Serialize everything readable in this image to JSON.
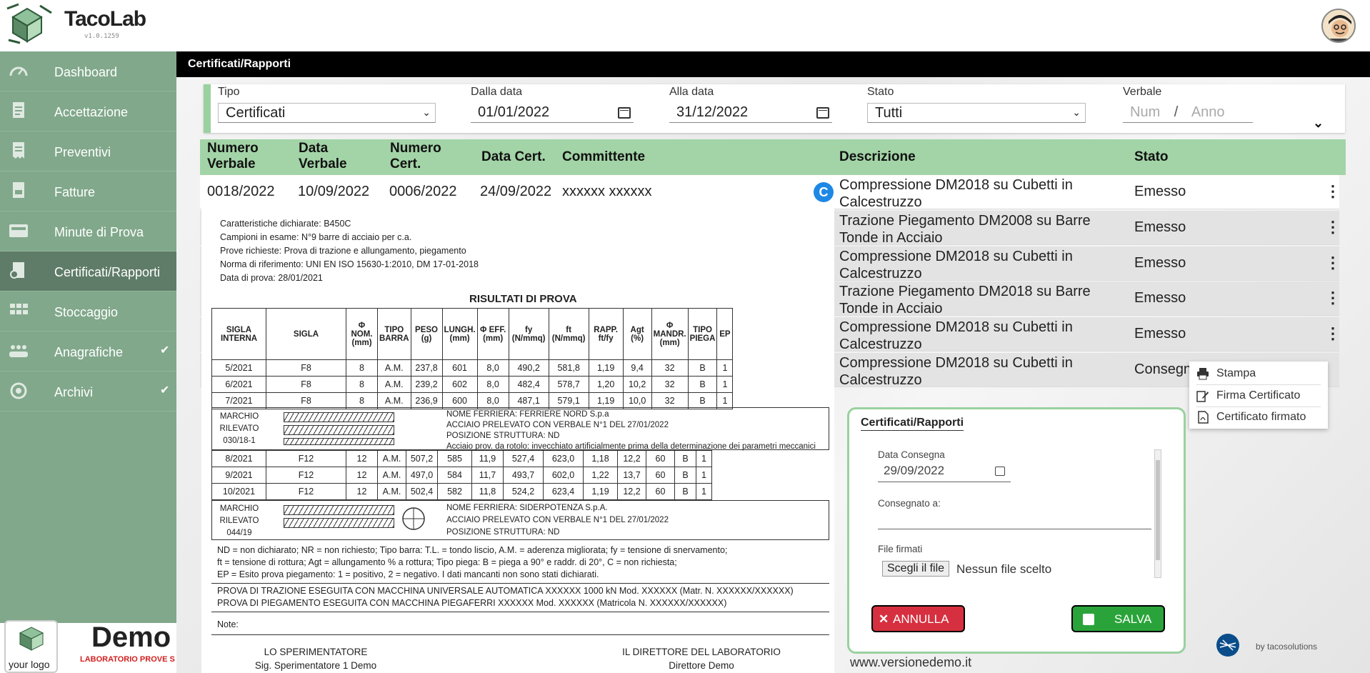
{
  "app": {
    "brand": "TacoLab",
    "version": "v1.0.1259"
  },
  "sidebar": {
    "items": [
      {
        "label": "Dashboard",
        "icon": "gauge-icon"
      },
      {
        "label": "Accettazione",
        "icon": "document-icon"
      },
      {
        "label": "Preventivi",
        "icon": "receipt-icon"
      },
      {
        "label": "Fatture",
        "icon": "invoice-icon"
      },
      {
        "label": "Minute di Prova",
        "icon": "inbox-icon"
      },
      {
        "label": "Certificati/Rapporti",
        "icon": "certificate-icon",
        "active": true
      },
      {
        "label": "Stoccaggio",
        "icon": "grid-icon"
      },
      {
        "label": "Anagrafiche",
        "icon": "people-icon",
        "expand": "✔"
      },
      {
        "label": "Archivi",
        "icon": "archive-icon",
        "expand": "✔"
      }
    ]
  },
  "page": {
    "title": "Certificati/Rapporti"
  },
  "filters": {
    "tipo": {
      "label": "Tipo",
      "value": "Certificati"
    },
    "dalla_data": {
      "label": "Dalla data",
      "value": "01/01/2022"
    },
    "alla_data": {
      "label": "Alla data",
      "value": "31/12/2022"
    },
    "stato": {
      "label": "Stato",
      "value": "Tutti"
    },
    "verbale": {
      "label": "Verbale",
      "num_placeholder": "Num",
      "sep": "/",
      "anno_placeholder": "Anno"
    }
  },
  "table": {
    "headers": {
      "numero_verbale": "Numero Verbale",
      "data_verbale": "Data Verbale",
      "numero_cert": "Numero Cert.",
      "data_cert": "Data Cert.",
      "committente": "Committente",
      "descrizione": "Descrizione",
      "stato": "Stato"
    },
    "rows": [
      {
        "numero_verbale": "0018/2022",
        "data_verbale": "10/09/2022",
        "numero_cert": "0006/2022",
        "data_cert": "24/09/2022",
        "committente": "xxxxxx xxxxxx",
        "badge": "C",
        "descrizione": "Compressione DM2018 su Cubetti in Calcestruzzo",
        "stato": "Emesso"
      },
      {
        "descrizione": "Trazione Piegamento DM2008 su Barre Tonde in Acciaio",
        "stato": "Emesso"
      },
      {
        "descrizione": "Compressione DM2018 su Cubetti in Calcestruzzo",
        "stato": "Emesso"
      },
      {
        "descrizione": "Trazione Piegamento DM2018 su Barre Tonde in Acciaio",
        "stato": "Emesso"
      },
      {
        "descrizione": "Compressione DM2018 su Cubetti in Calcestruzzo",
        "stato": "Emesso"
      },
      {
        "descrizione": "Compressione DM2018 su Cubetti in Calcestruzzo",
        "stato": "Consegn"
      }
    ]
  },
  "preview": {
    "lines": [
      "Caratteristiche dichiarate: B450C",
      "Campioni in esame: N°9 barre di acciaio per c.a.",
      "Prove richieste: Prova di trazione e allungamento, piegamento",
      "Norma di riferimento: UNI EN ISO 15630-1:2010, DM 17-01-2018",
      "Data di prova: 28/01/2021"
    ],
    "results_title": "RISULTATI DI PROVA",
    "columns": [
      "SIGLA INTERNA",
      "SIGLA",
      "Φ NOM. (mm)",
      "TIPO BARRA",
      "PESO (g)",
      "LUNGH. (mm)",
      "Φ EFF. (mm)",
      "fy (N/mmq)",
      "ft (N/mmq)",
      "RAPP. ft/fy",
      "Agt (%)",
      "Φ MANDR. (mm)",
      "TIPO PIEGA",
      "EP"
    ],
    "group1": [
      [
        "5/2021",
        "F8",
        "8",
        "A.M.",
        "237,8",
        "601",
        "8,0",
        "490,2",
        "581,8",
        "1,19",
        "9,4",
        "32",
        "B",
        "1"
      ],
      [
        "6/2021",
        "F8",
        "8",
        "A.M.",
        "239,2",
        "602",
        "8,0",
        "482,4",
        "578,7",
        "1,20",
        "10,2",
        "32",
        "B",
        "1"
      ],
      [
        "7/2021",
        "F8",
        "8",
        "A.M.",
        "236,9",
        "600",
        "8,0",
        "487,1",
        "579,1",
        "1,19",
        "10,0",
        "32",
        "B",
        "1"
      ]
    ],
    "marchio1": {
      "label": "MARCHIO RILEVATO 030/18-1",
      "info": [
        "NOME FERRIERA: FERRIERE NORD S.p.a",
        "ACCIAIO PRELEVATO CON VERBALE N°1 DEL 27/01/2022",
        "POSIZIONE STRUTTURA: ND",
        "Acciaio prov. da rotolo: invecchiato artificialmente prima della determinazione dei parametri meccanici"
      ]
    },
    "group2": [
      [
        "8/2021",
        "F12",
        "12",
        "A.M.",
        "507,2",
        "585",
        "11,9",
        "527,4",
        "623,0",
        "1,18",
        "12,2",
        "60",
        "B",
        "1"
      ],
      [
        "9/2021",
        "F12",
        "12",
        "A.M.",
        "497,0",
        "584",
        "11,7",
        "493,7",
        "602,0",
        "1,22",
        "13,7",
        "60",
        "B",
        "1"
      ],
      [
        "10/2021",
        "F12",
        "12",
        "A.M.",
        "502,4",
        "582",
        "11,8",
        "524,2",
        "623,4",
        "1,19",
        "12,2",
        "60",
        "B",
        "1"
      ]
    ],
    "marchio2": {
      "label": "MARCHIO RILEVATO 044/19",
      "info": [
        "NOME FERRIERA: SIDERPOTENZA S.p.A.",
        "ACCIAIO PRELEVATO CON VERBALE N°1 DEL 27/01/2022",
        "POSIZIONE STRUTTURA: ND"
      ]
    },
    "legend": [
      "ND = non dichiarato; NR = non richiesto; Tipo barra: T.L. = tondo liscio, A.M. = aderenza migliorata; fy = tensione di snervamento;",
      "ft = tensione di rottura; Agt = allungamento % a rottura; Tipo piega: B = piega a 90° e raddr. di 20°, C = non richiesta;",
      "EP = Esito prova piegamento: 1 = positivo, 2 = negativo. I dati mancanti non sono stati dichiarati."
    ],
    "machines": [
      "PROVA DI TRAZIONE ESEGUITA CON MACCHINA UNIVERSALE AUTOMATICA XXXXXX 1000 kN Mod. XXXXXX (Matr. N. XXXXXX/XXXXXX)",
      "PROVA DI PIEGAMENTO ESEGUITA CON MACCHINA PIEGAFERRI XXXXXX Mod. XXXXXX (Matricola N. XXXXXX/XXXXXX)"
    ],
    "note": "Note:",
    "sig_left": {
      "role": "LO SPERIMENTATORE",
      "name": "Sig. Sperimentatore 1 Demo"
    },
    "sig_right": {
      "role": "IL DIRETTORE DEL LABORATORIO",
      "name": "Direttore Demo"
    }
  },
  "menu": {
    "items": [
      {
        "label": "Stampa",
        "icon": "printer-icon"
      },
      {
        "label": "Firma Certificato",
        "icon": "signature-icon"
      },
      {
        "label": "Certificato firmato",
        "icon": "pdf-icon"
      }
    ]
  },
  "modal": {
    "title": "Certificati/Rapporti",
    "data_consegna_label": "Data Consegna",
    "data_consegna_value": "29/09/2022",
    "consegnato_label": "Consegnato a:",
    "consegnato_value": "",
    "file_label": "File firmati",
    "file_button": "Scegli il file",
    "file_name": "Nessun file scelto",
    "cancel": "ANNULLA",
    "save": "SALVA"
  },
  "footer": {
    "your_logo": "your logo",
    "demo": "Demo",
    "lab": "LABORATORIO PROVE S",
    "website": "www.versionedemo.it",
    "by": "by tacosolutions"
  },
  "colors": {
    "sidebar": "#81a88b",
    "active": "#5f7c68",
    "header_row": "#a3d4a7",
    "accent": "#9ad19f",
    "cancel": "#d63040",
    "save": "#2aa43a"
  }
}
